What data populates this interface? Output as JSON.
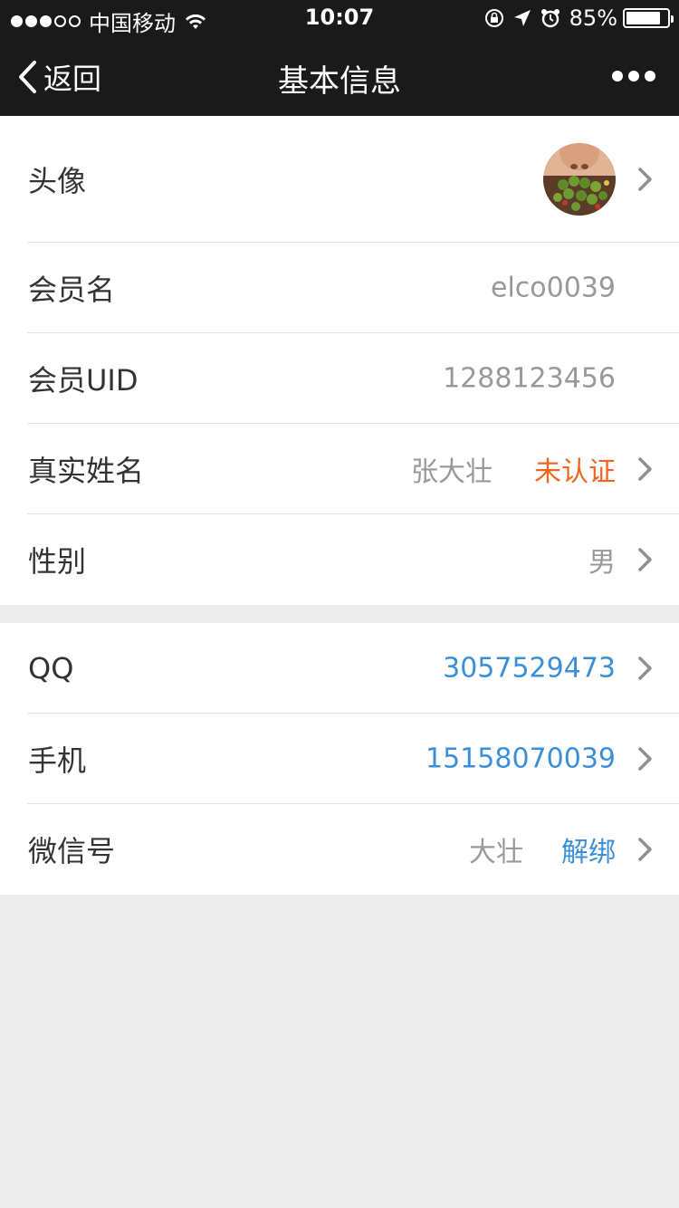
{
  "status_bar": {
    "carrier": "中国移动",
    "time": "10:07",
    "battery_percent": "85%",
    "battery_level": 0.85,
    "signal_strength": 3
  },
  "nav": {
    "back_label": "返回",
    "title": "基本信息"
  },
  "profile": {
    "avatar_label": "头像",
    "member_name_label": "会员名",
    "member_name_value": "elco0039",
    "uid_label": "会员UID",
    "uid_value": "1288123456",
    "real_name_label": "真实姓名",
    "real_name_value": "张大壮",
    "real_name_status": "未认证",
    "gender_label": "性别",
    "gender_value": "男"
  },
  "bindings": {
    "qq_label": "QQ",
    "qq_value": "3057529473",
    "phone_label": "手机",
    "phone_value": "15158070039",
    "wechat_label": "微信号",
    "wechat_value": "大壮",
    "wechat_action": "解绑"
  },
  "colors": {
    "nav_bg": "#1a1a1a",
    "accent_blue": "#3b8fd8",
    "warning_orange": "#f0661e",
    "value_gray": "#999999"
  }
}
